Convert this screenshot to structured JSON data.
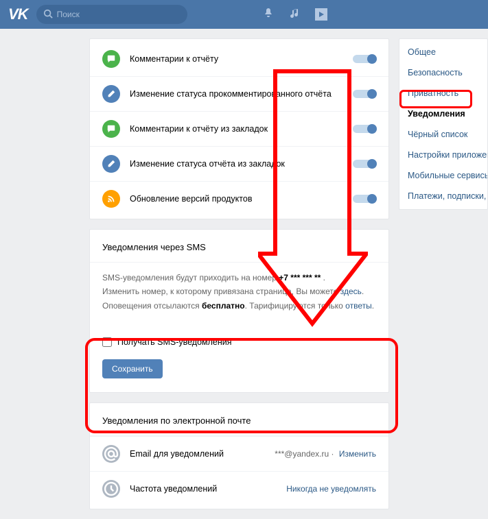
{
  "header": {
    "logo": "VK",
    "search_placeholder": "Поиск"
  },
  "notif_items": [
    {
      "icon": "chat",
      "color": "green",
      "label": "Комментарии к отчёту"
    },
    {
      "icon": "pencil",
      "color": "blue",
      "label": "Изменение статуса прокомментированного отчёта"
    },
    {
      "icon": "chat",
      "color": "green",
      "label": "Комментарии к отчёту из закладок"
    },
    {
      "icon": "pencil",
      "color": "blue",
      "label": "Изменение статуса отчёта из закладок"
    },
    {
      "icon": "rss",
      "color": "orange",
      "label": "Обновление версий продуктов"
    }
  ],
  "sms": {
    "title": "Уведомления через SMS",
    "text_prefix": "SMS-уведомления будут приходить на номер ",
    "phone": "+7 *** *** **",
    "text_line2_a": "Изменить номер, к которому привязана страница, Вы можете ",
    "here": "здесь",
    "text_line3_a": "Оповещения отсылаются ",
    "free": "бесплатно",
    "text_line3_b": ". Тарифицируются только ",
    "answers": "ответы",
    "checkbox": "Получать SMS-уведомления",
    "save": "Сохранить"
  },
  "email": {
    "title": "Уведомления по электронной почте",
    "row1_label": "Email для уведомлений",
    "row1_value": "***@yandex.ru",
    "row1_action": "Изменить",
    "row2_label": "Частота уведомлений",
    "row2_value": "Никогда не уведомлять"
  },
  "sidebar": [
    "Общее",
    "Безопасность",
    "Приватность",
    "Уведомления",
    "Чёрный список",
    "Настройки приложений",
    "Мобильные сервисы",
    "Платежи, подписки, переводы"
  ],
  "sidebar_active": 3
}
